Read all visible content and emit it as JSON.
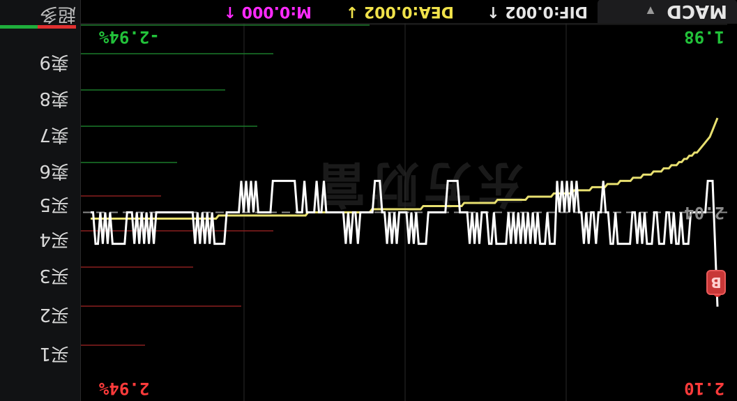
{
  "orderbook": {
    "label_bottom": "超多",
    "levels": [
      {
        "label": "买1"
      },
      {
        "label": "买2"
      },
      {
        "label": "买3"
      },
      {
        "label": "买4"
      },
      {
        "label": "买5"
      },
      {
        "label": "卖6"
      },
      {
        "label": "卖7"
      },
      {
        "label": "卖8"
      },
      {
        "label": "卖9"
      }
    ],
    "buy_ratio": 0.5,
    "colors": {
      "buy": "#e03030",
      "sell": "#1fae3c"
    }
  },
  "chart": {
    "labels": {
      "price_high": "2.10",
      "pct_high": "2.94%",
      "price_ref": "2.04",
      "price_low": "1.98",
      "pct_low": "-2.94%"
    },
    "badge": "B",
    "watermark": "东方财富",
    "colors": {
      "price_line": "#ffffff",
      "avg_line": "#e8e070",
      "up": "#ff3b3b",
      "down": "#22c23a",
      "ref_line": "#8a8a8a",
      "grid": "#2a2a2a"
    }
  },
  "macd": {
    "button_label": "MACD",
    "dif": "DIF:0.002 ↑",
    "dea": "DEA:0.002 ↓",
    "m": "M:0.000 ↑",
    "colors": {
      "dif": "#e6e6e6",
      "dea": "#f0e24a",
      "m": "#ff2aff"
    }
  },
  "chart_data": {
    "type": "line",
    "ylim": [
      1.98,
      2.1
    ],
    "reference": 2.04,
    "series": [
      {
        "values": [
          2.07,
          2.05,
          2.03,
          2.03,
          2.03,
          2.04,
          2.04,
          2.04,
          2.04,
          2.04,
          2.04,
          2.04,
          2.05,
          2.05,
          2.05,
          2.04,
          2.05,
          2.05,
          2.04,
          2.05,
          2.04,
          2.04,
          2.05,
          2.05,
          2.05,
          2.04,
          2.04,
          2.05,
          2.05,
          2.05,
          2.04,
          2.05,
          2.04,
          2.05,
          2.04,
          2.04,
          2.05,
          2.05,
          2.05,
          2.05,
          2.05,
          2.05,
          2.04,
          2.05,
          2.05,
          2.04,
          2.04,
          2.03,
          2.04,
          2.04,
          2.05,
          2.04,
          2.04,
          2.05,
          2.04,
          2.05,
          2.04,
          2.04,
          2.03,
          2.04,
          2.03,
          2.04,
          2.03,
          2.04,
          2.03,
          2.04,
          2.03,
          2.05,
          2.05,
          2.05,
          2.04,
          2.05,
          2.05,
          2.05,
          2.04,
          2.05,
          2.04,
          2.05,
          2.04,
          2.05,
          2.04,
          2.05,
          2.04,
          2.05,
          2.04,
          2.05,
          2.04,
          2.05,
          2.05,
          2.05,
          2.05,
          2.05,
          2.04,
          2.05,
          2.05,
          2.04,
          2.04,
          2.04,
          2.05,
          2.04,
          2.05,
          2.04,
          2.05,
          2.04,
          2.04,
          2.04,
          2.04,
          2.03,
          2.03,
          2.03,
          2.03,
          2.03,
          2.04,
          2.04,
          2.04,
          2.04,
          2.04,
          2.04,
          2.04,
          2.04,
          2.05,
          2.05,
          2.05,
          2.05,
          2.04,
          2.05,
          2.04,
          2.05,
          2.04,
          2.04,
          2.04,
          2.04,
          2.05,
          2.04,
          2.05,
          2.04,
          2.05,
          2.04,
          2.04,
          2.03,
          2.03,
          2.03,
          2.04,
          2.04,
          2.04,
          2.04,
          2.04,
          2.04,
          2.05,
          2.04,
          2.04,
          2.05,
          2.04,
          2.05,
          2.04,
          2.04,
          2.04,
          2.04,
          2.04,
          2.04,
          2.04,
          2.04,
          2.03,
          2.04,
          2.04,
          2.03,
          2.04,
          2.04,
          2.04,
          2.04,
          2.03,
          2.04,
          2.04,
          2.04,
          2.03,
          2.03,
          2.03,
          2.03,
          2.03,
          2.03,
          2.03,
          2.03,
          2.03,
          2.03,
          2.04,
          2.04,
          2.04,
          2.04,
          2.04,
          2.04,
          2.03,
          2.04,
          2.03,
          2.04,
          2.03,
          2.04,
          2.03,
          2.04,
          2.04,
          2.04,
          2.04,
          2.04,
          2.04,
          2.05,
          2.05,
          2.05,
          2.05,
          2.05,
          2.04,
          2.05,
          2.04,
          2.05,
          2.04,
          2.05,
          2.04,
          2.05,
          2.04,
          2.04,
          2.04,
          2.04,
          2.04,
          2.04,
          2.04,
          2.04,
          2.04,
          2.04,
          2.04,
          2.04,
          2.04,
          2.04,
          2.04,
          2.04,
          2.05,
          2.04,
          2.05,
          2.04,
          2.05,
          2.04,
          2.05,
          2.04,
          2.05,
          2.04,
          2.04,
          2.04,
          2.05,
          2.05,
          2.05,
          2.05,
          2.05,
          2.05,
          2.04,
          2.05,
          2.04,
          2.05,
          2.04,
          2.05,
          2.05,
          2.04,
          2.04
        ]
      },
      {
        "values": [
          2.01,
          2.012,
          2.014,
          2.016,
          2.017,
          2.018,
          2.019,
          2.02,
          2.021,
          2.021,
          2.022,
          2.022,
          2.023,
          2.023,
          2.024,
          2.024,
          2.025,
          2.025,
          2.025,
          2.026,
          2.026,
          2.026,
          2.027,
          2.027,
          2.027,
          2.027,
          2.028,
          2.028,
          2.028,
          2.028,
          2.029,
          2.029,
          2.029,
          2.029,
          2.03,
          2.03,
          2.03,
          2.03,
          2.03,
          2.031,
          2.031,
          2.031,
          2.031,
          2.031,
          2.032,
          2.032,
          2.032,
          2.032,
          2.032,
          2.032,
          2.033,
          2.033,
          2.033,
          2.033,
          2.033,
          2.033,
          2.033,
          2.034,
          2.034,
          2.034,
          2.034,
          2.034,
          2.034,
          2.034,
          2.034,
          2.035,
          2.035,
          2.035,
          2.035,
          2.035,
          2.035,
          2.035,
          2.035,
          2.035,
          2.035,
          2.036,
          2.036,
          2.036,
          2.036,
          2.036,
          2.036,
          2.036,
          2.036,
          2.036,
          2.036,
          2.036,
          2.036,
          2.037,
          2.037,
          2.037,
          2.037,
          2.037,
          2.037,
          2.037,
          2.037,
          2.037,
          2.037,
          2.037,
          2.037,
          2.037,
          2.038,
          2.038,
          2.038,
          2.038,
          2.038,
          2.038,
          2.038,
          2.038,
          2.038,
          2.038,
          2.038,
          2.038,
          2.038,
          2.038,
          2.038,
          2.038,
          2.039,
          2.039,
          2.039,
          2.039,
          2.039,
          2.039,
          2.039,
          2.039,
          2.039,
          2.039,
          2.039,
          2.039,
          2.039,
          2.039,
          2.039,
          2.039,
          2.039,
          2.039,
          2.039,
          2.039,
          2.04,
          2.04,
          2.04,
          2.04,
          2.04,
          2.04,
          2.04,
          2.04,
          2.04,
          2.04,
          2.04,
          2.04,
          2.04,
          2.04,
          2.04,
          2.04,
          2.04,
          2.04,
          2.04,
          2.04,
          2.04,
          2.04,
          2.04,
          2.04,
          2.04,
          2.041,
          2.041,
          2.041,
          2.041,
          2.041,
          2.041,
          2.041,
          2.041,
          2.041,
          2.041,
          2.041,
          2.041,
          2.041,
          2.041,
          2.041,
          2.041,
          2.041,
          2.041,
          2.041,
          2.041,
          2.041,
          2.041,
          2.041,
          2.041,
          2.041,
          2.041,
          2.041,
          2.041,
          2.041,
          2.041,
          2.041,
          2.041,
          2.041,
          2.041,
          2.041,
          2.042,
          2.042,
          2.042,
          2.042,
          2.042,
          2.042,
          2.042,
          2.042,
          2.042,
          2.042,
          2.042,
          2.042,
          2.042,
          2.042,
          2.042,
          2.042,
          2.042,
          2.042,
          2.042,
          2.042,
          2.042,
          2.042,
          2.042,
          2.042,
          2.042,
          2.042,
          2.042,
          2.042,
          2.042,
          2.042,
          2.042,
          2.042,
          2.042,
          2.042,
          2.042,
          2.042,
          2.042,
          2.042,
          2.042,
          2.042,
          2.042,
          2.042,
          2.042,
          2.042,
          2.042,
          2.042,
          2.042,
          2.042,
          2.042,
          2.042
        ]
      }
    ],
    "orderbook_volumes": {
      "buy": [
        0.2,
        0.5,
        0.35,
        0.6,
        0.25
      ],
      "sell": [
        0.3,
        0.55,
        0.45,
        0.6,
        0.9
      ]
    }
  }
}
